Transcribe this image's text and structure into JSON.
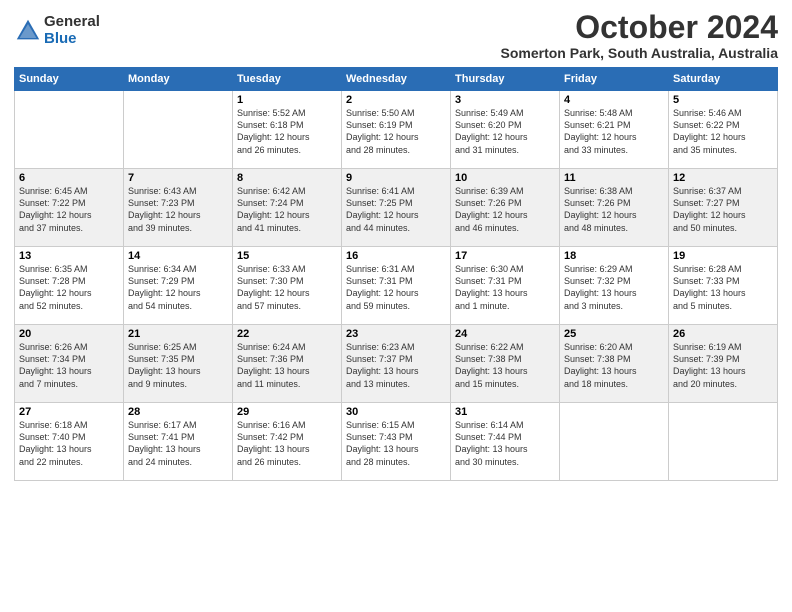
{
  "logo": {
    "general": "General",
    "blue": "Blue"
  },
  "header": {
    "month": "October 2024",
    "location": "Somerton Park, South Australia, Australia"
  },
  "weekdays": [
    "Sunday",
    "Monday",
    "Tuesday",
    "Wednesday",
    "Thursday",
    "Friday",
    "Saturday"
  ],
  "weeks": [
    [
      {
        "day": "",
        "info": ""
      },
      {
        "day": "",
        "info": ""
      },
      {
        "day": "1",
        "info": "Sunrise: 5:52 AM\nSunset: 6:18 PM\nDaylight: 12 hours\nand 26 minutes."
      },
      {
        "day": "2",
        "info": "Sunrise: 5:50 AM\nSunset: 6:19 PM\nDaylight: 12 hours\nand 28 minutes."
      },
      {
        "day": "3",
        "info": "Sunrise: 5:49 AM\nSunset: 6:20 PM\nDaylight: 12 hours\nand 31 minutes."
      },
      {
        "day": "4",
        "info": "Sunrise: 5:48 AM\nSunset: 6:21 PM\nDaylight: 12 hours\nand 33 minutes."
      },
      {
        "day": "5",
        "info": "Sunrise: 5:46 AM\nSunset: 6:22 PM\nDaylight: 12 hours\nand 35 minutes."
      }
    ],
    [
      {
        "day": "6",
        "info": "Sunrise: 6:45 AM\nSunset: 7:22 PM\nDaylight: 12 hours\nand 37 minutes."
      },
      {
        "day": "7",
        "info": "Sunrise: 6:43 AM\nSunset: 7:23 PM\nDaylight: 12 hours\nand 39 minutes."
      },
      {
        "day": "8",
        "info": "Sunrise: 6:42 AM\nSunset: 7:24 PM\nDaylight: 12 hours\nand 41 minutes."
      },
      {
        "day": "9",
        "info": "Sunrise: 6:41 AM\nSunset: 7:25 PM\nDaylight: 12 hours\nand 44 minutes."
      },
      {
        "day": "10",
        "info": "Sunrise: 6:39 AM\nSunset: 7:26 PM\nDaylight: 12 hours\nand 46 minutes."
      },
      {
        "day": "11",
        "info": "Sunrise: 6:38 AM\nSunset: 7:26 PM\nDaylight: 12 hours\nand 48 minutes."
      },
      {
        "day": "12",
        "info": "Sunrise: 6:37 AM\nSunset: 7:27 PM\nDaylight: 12 hours\nand 50 minutes."
      }
    ],
    [
      {
        "day": "13",
        "info": "Sunrise: 6:35 AM\nSunset: 7:28 PM\nDaylight: 12 hours\nand 52 minutes."
      },
      {
        "day": "14",
        "info": "Sunrise: 6:34 AM\nSunset: 7:29 PM\nDaylight: 12 hours\nand 54 minutes."
      },
      {
        "day": "15",
        "info": "Sunrise: 6:33 AM\nSunset: 7:30 PM\nDaylight: 12 hours\nand 57 minutes."
      },
      {
        "day": "16",
        "info": "Sunrise: 6:31 AM\nSunset: 7:31 PM\nDaylight: 12 hours\nand 59 minutes."
      },
      {
        "day": "17",
        "info": "Sunrise: 6:30 AM\nSunset: 7:31 PM\nDaylight: 13 hours\nand 1 minute."
      },
      {
        "day": "18",
        "info": "Sunrise: 6:29 AM\nSunset: 7:32 PM\nDaylight: 13 hours\nand 3 minutes."
      },
      {
        "day": "19",
        "info": "Sunrise: 6:28 AM\nSunset: 7:33 PM\nDaylight: 13 hours\nand 5 minutes."
      }
    ],
    [
      {
        "day": "20",
        "info": "Sunrise: 6:26 AM\nSunset: 7:34 PM\nDaylight: 13 hours\nand 7 minutes."
      },
      {
        "day": "21",
        "info": "Sunrise: 6:25 AM\nSunset: 7:35 PM\nDaylight: 13 hours\nand 9 minutes."
      },
      {
        "day": "22",
        "info": "Sunrise: 6:24 AM\nSunset: 7:36 PM\nDaylight: 13 hours\nand 11 minutes."
      },
      {
        "day": "23",
        "info": "Sunrise: 6:23 AM\nSunset: 7:37 PM\nDaylight: 13 hours\nand 13 minutes."
      },
      {
        "day": "24",
        "info": "Sunrise: 6:22 AM\nSunset: 7:38 PM\nDaylight: 13 hours\nand 15 minutes."
      },
      {
        "day": "25",
        "info": "Sunrise: 6:20 AM\nSunset: 7:38 PM\nDaylight: 13 hours\nand 18 minutes."
      },
      {
        "day": "26",
        "info": "Sunrise: 6:19 AM\nSunset: 7:39 PM\nDaylight: 13 hours\nand 20 minutes."
      }
    ],
    [
      {
        "day": "27",
        "info": "Sunrise: 6:18 AM\nSunset: 7:40 PM\nDaylight: 13 hours\nand 22 minutes."
      },
      {
        "day": "28",
        "info": "Sunrise: 6:17 AM\nSunset: 7:41 PM\nDaylight: 13 hours\nand 24 minutes."
      },
      {
        "day": "29",
        "info": "Sunrise: 6:16 AM\nSunset: 7:42 PM\nDaylight: 13 hours\nand 26 minutes."
      },
      {
        "day": "30",
        "info": "Sunrise: 6:15 AM\nSunset: 7:43 PM\nDaylight: 13 hours\nand 28 minutes."
      },
      {
        "day": "31",
        "info": "Sunrise: 6:14 AM\nSunset: 7:44 PM\nDaylight: 13 hours\nand 30 minutes."
      },
      {
        "day": "",
        "info": ""
      },
      {
        "day": "",
        "info": ""
      }
    ]
  ]
}
